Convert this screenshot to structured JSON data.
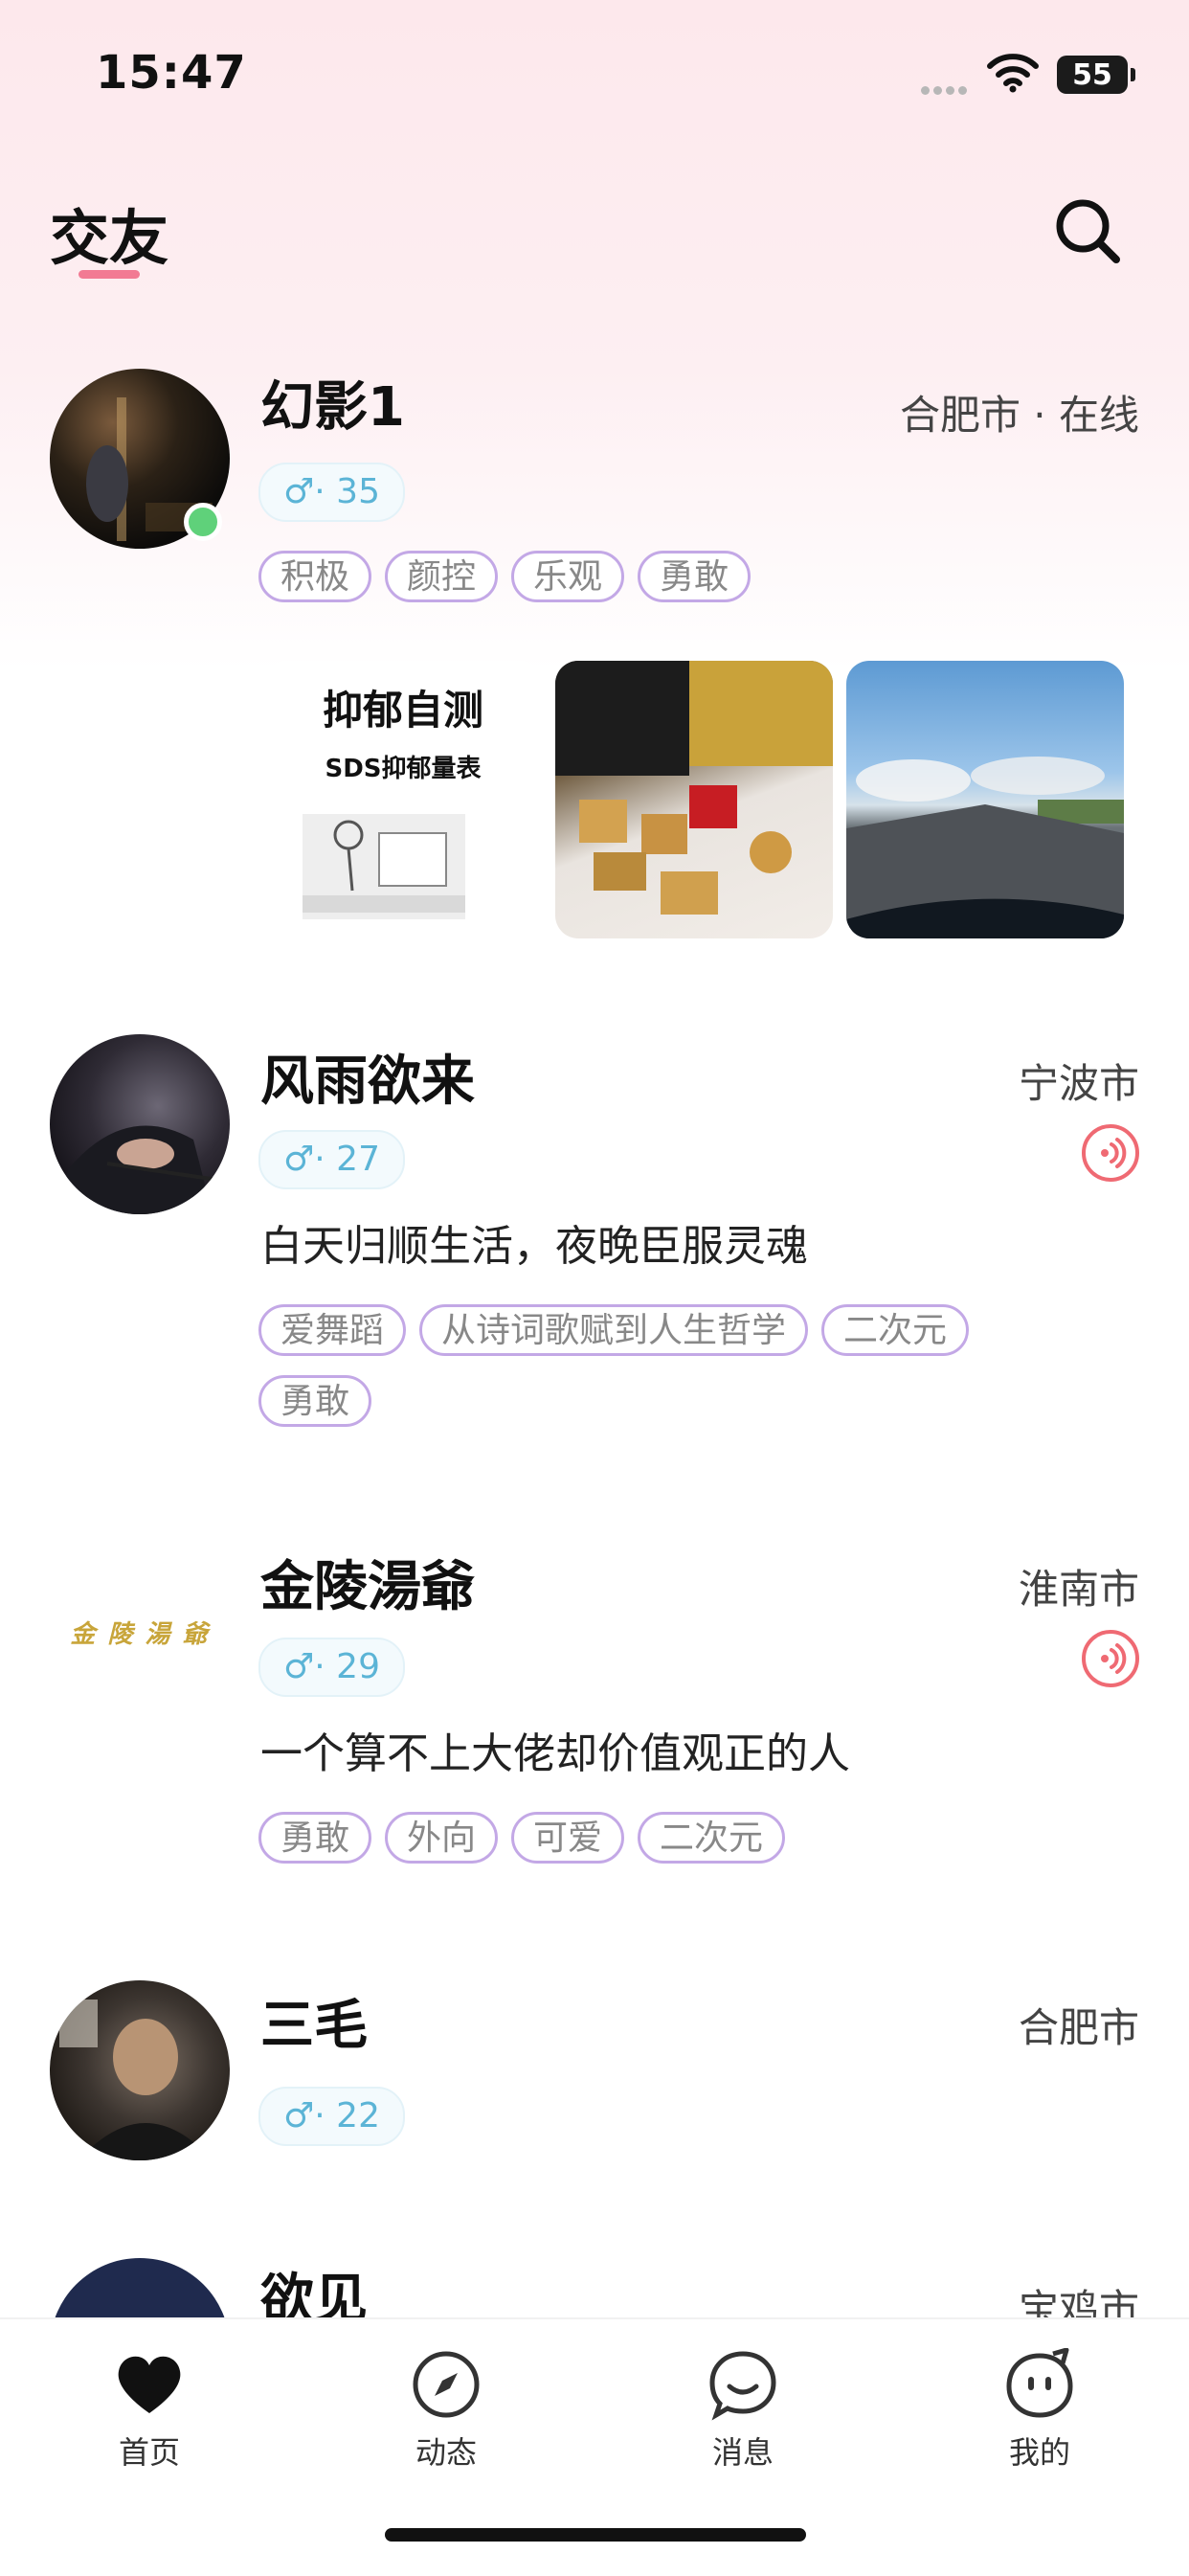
{
  "status_bar": {
    "time": "15:47",
    "battery": "55"
  },
  "header": {
    "title": "交友"
  },
  "users": [
    {
      "name": "幻影1",
      "location": "合肥市 · 在线",
      "gender_age": "♂· 35",
      "tags": [
        "积极",
        "颜控",
        "乐观",
        "勇敢"
      ],
      "photo_text": {
        "title": "抑郁自测",
        "subtitle": "SDS抑郁量表"
      }
    },
    {
      "name": "风雨欲来",
      "location": "宁波市",
      "gender_age": "♂· 27",
      "bio": "白天归顺生活，夜晚臣服灵魂",
      "tags": [
        "爱舞蹈",
        "从诗词歌赋到人生哲学",
        "二次元",
        "勇敢"
      ]
    },
    {
      "name": "金陵湯爺",
      "avatar_text": "金 陵 湯 爺",
      "location": "淮南市",
      "gender_age": "♂· 29",
      "bio": "一个算不上大佬却价值观正的人",
      "tags": [
        "勇敢",
        "外向",
        "可爱",
        "二次元"
      ]
    },
    {
      "name": "三毛",
      "location": "合肥市",
      "gender_age": "♂· 22"
    },
    {
      "name": "欲见",
      "location": "宝鸡市"
    }
  ],
  "tabbar": {
    "home": "首页",
    "moments": "动态",
    "messages": "消息",
    "me": "我的"
  },
  "colors": {
    "accent_pink": "#f27a93",
    "online_green": "#5fd17a",
    "gender_blue": "#5bb4d6",
    "voice_red": "#ef6a73"
  }
}
